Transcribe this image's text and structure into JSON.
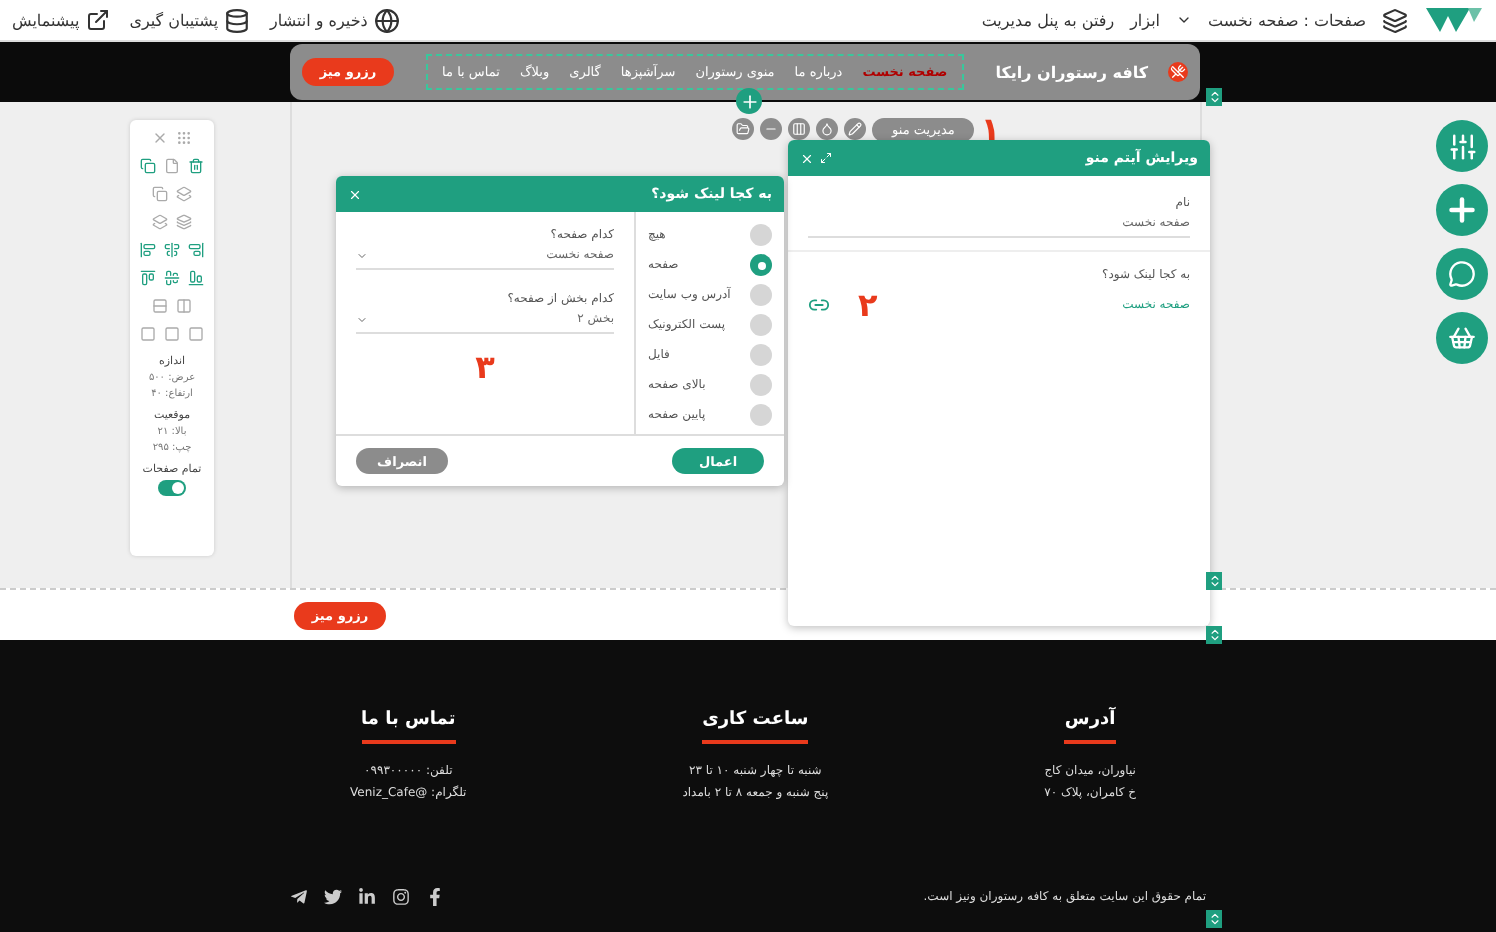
{
  "topbar": {
    "pages_menu": "صفحات : صفحه نخست",
    "tools": "ابزار",
    "admin_link": "رفتن به پنل مدیریت",
    "actions": [
      {
        "label": "ذخیره و انتشار"
      },
      {
        "label": "پشتیبان گیری"
      },
      {
        "label": "پیشنمایش"
      }
    ]
  },
  "header": {
    "site_name": "کافه رستوران رایکا",
    "reserve_button": "رزرو میز",
    "menu": [
      {
        "label": "صفحه نخست",
        "selected": true
      },
      {
        "label": "درباره ما",
        "selected": false
      },
      {
        "label": "منوی رستوران",
        "selected": false
      },
      {
        "label": "سرآشپزها",
        "selected": false
      },
      {
        "label": "گالری",
        "selected": false
      },
      {
        "label": "وبلاگ",
        "selected": false
      },
      {
        "label": "تماس با ما",
        "selected": false
      }
    ]
  },
  "menu_toolbar": {
    "manage_label": "مدیریت منو",
    "marker": "۱"
  },
  "edit_dialog": {
    "title": "ویرایش آیتم منو",
    "name_label": "نام",
    "name_value": "صفحه نخست",
    "link_label": "به کجا لینک شود؟",
    "link_value": "صفحه نخست",
    "marker": "۲"
  },
  "link_dialog": {
    "title": "به کجا لینک شود؟",
    "options": [
      {
        "label": "هیچ",
        "selected": false
      },
      {
        "label": "صفحه",
        "selected": true
      },
      {
        "label": "آدرس وب سایت",
        "selected": false
      },
      {
        "label": "پست الکترونیک",
        "selected": false
      },
      {
        "label": "فایل",
        "selected": false
      },
      {
        "label": "بالای صفحه",
        "selected": false
      },
      {
        "label": "پایین صفحه",
        "selected": false
      }
    ],
    "page_label": "کدام صفحه؟",
    "page_value": "صفحه نخست",
    "section_label": "کدام بخش از صفحه؟",
    "section_value": "بخش ۲",
    "marker": "۳",
    "apply_button": "اعمال",
    "cancel_button": "انصراف"
  },
  "tool_palette": {
    "size_title": "اندازه",
    "fields_size": [
      {
        "label": "عرض:",
        "value": "۵۰۰"
      },
      {
        "label": "ارتفاع:",
        "value": "۴۰"
      }
    ],
    "position_title": "موقعیت",
    "fields_position": [
      {
        "label": "بالا:",
        "value": "۲۱"
      },
      {
        "label": "چپ:",
        "value": "۲۹۵"
      }
    ],
    "all_pages_label": "تمام صفحات",
    "all_pages_on": true
  },
  "section_button": "رزرو میز",
  "footer": {
    "columns": [
      {
        "title": "آدرس",
        "lines": [
          "نیاوران، میدان کاج",
          "خ کامران، پلاک ۷۰"
        ]
      },
      {
        "title": "ساعت کاری",
        "lines": [
          "شنبه تا چهار شنبه ۱۰ تا ۲۳",
          "پنج شنبه و جمعه ۸ تا ۲ بامداد"
        ]
      },
      {
        "title": "تماس با ما",
        "lines": [
          "تلفن: ۰۹۹۳۰۰۰۰۰",
          "تلگرام: @Veniz_Cafe"
        ]
      }
    ],
    "copyright": "تمام حقوق این سایت متعلق به کافه رستوران ونیز است."
  }
}
